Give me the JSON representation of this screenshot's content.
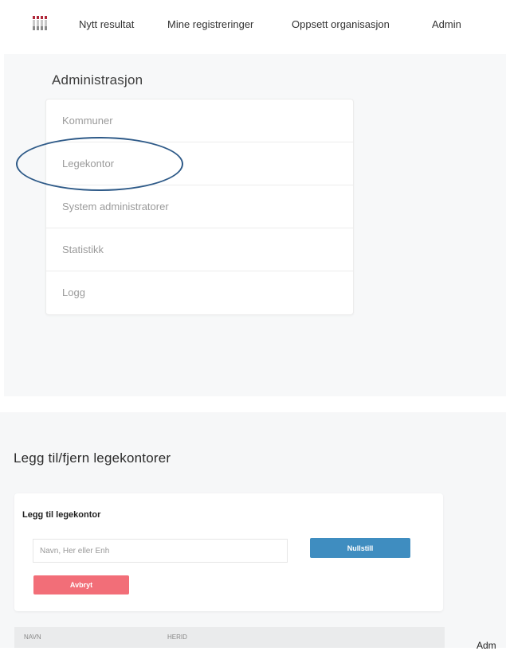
{
  "nav": {
    "logo_icon": "test-tubes-logo-icon",
    "links": [
      "Nytt resultat",
      "Mine registreringer",
      "Oppsett organisasjon",
      "Admin"
    ]
  },
  "admin": {
    "title": "Administrasjon",
    "menu": [
      "Kommuner",
      "Legekontor",
      "System administratorer",
      "Statistikk",
      "Logg"
    ],
    "highlighted_item": "Legekontor"
  },
  "legekontor": {
    "page_title": "Legg til/fjern legekontorer",
    "form_title": "Legg til legekontor",
    "search_placeholder": "Navn, Her eller Enh",
    "add_button": "Nullstill",
    "cancel_button": "Avbryt",
    "table_headers": [
      "NAVN",
      "HERID"
    ],
    "side_text": "Adm"
  },
  "colors": {
    "primary_button": "#3f8dc0",
    "cancel_button": "#f26e78",
    "highlight": "#2e5a88",
    "logo": "#b0283a"
  }
}
